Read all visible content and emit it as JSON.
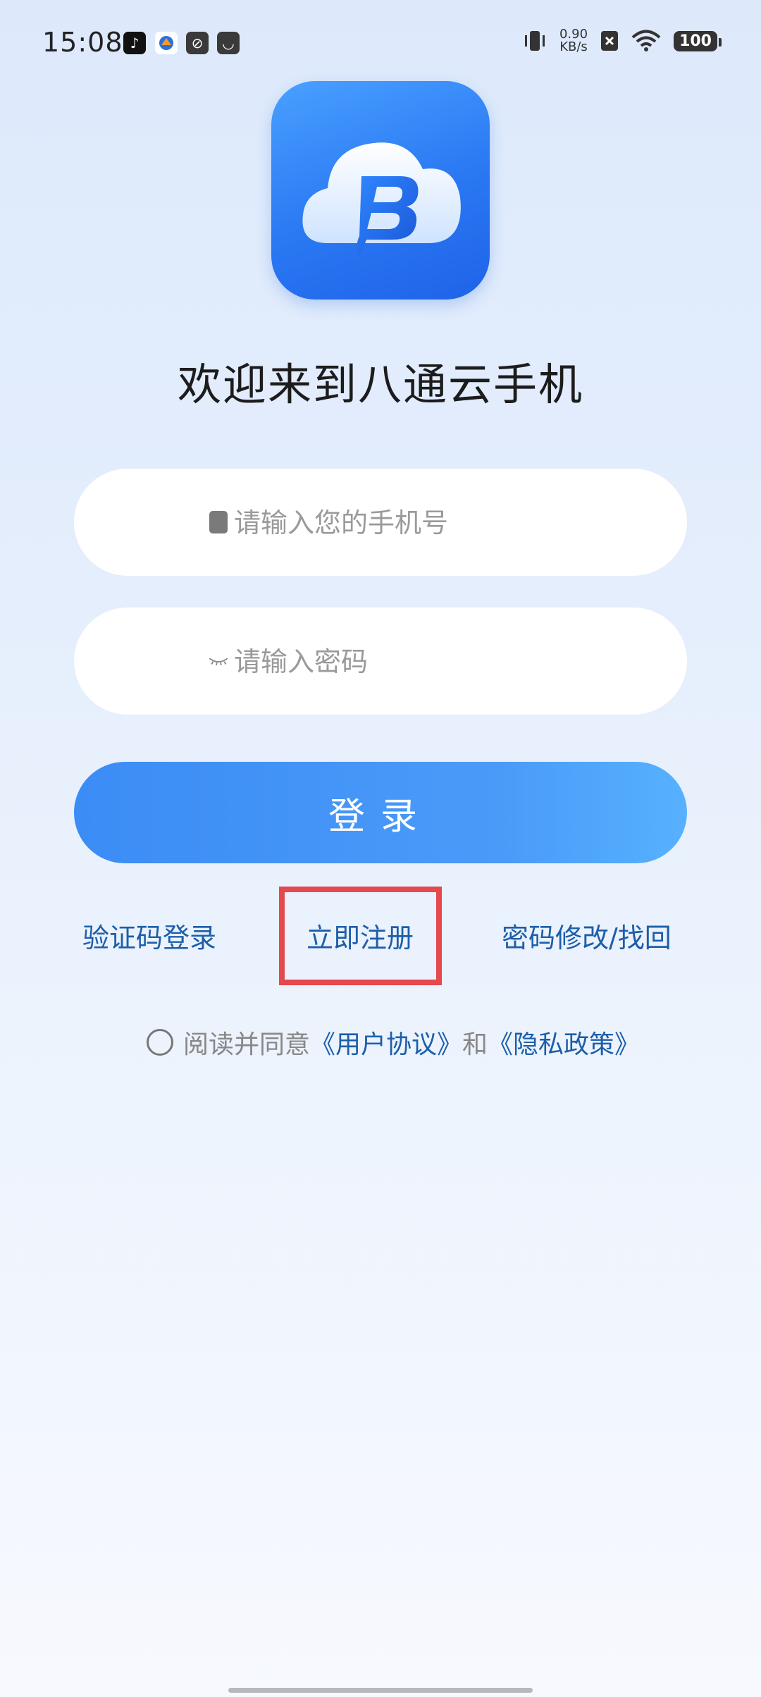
{
  "status_bar": {
    "time": "15:08",
    "net_speed_value": "0.90",
    "net_speed_unit": "KB/s",
    "battery": "100"
  },
  "welcome": {
    "title": "欢迎来到八通云手机"
  },
  "form": {
    "phone_placeholder": "请输入您的手机号",
    "password_placeholder": "请输入密码",
    "login_label": "登录"
  },
  "links": {
    "sms_login": "验证码登录",
    "register": "立即注册",
    "recover_password": "密码修改/找回"
  },
  "agreement": {
    "prefix": "阅读并同意",
    "user_agreement": "《用户协议》",
    "and": "和",
    "privacy_policy": "《隐私政策》"
  },
  "colors": {
    "accent": "#3b8cf5",
    "link": "#1d5eaa",
    "highlight": "#e5484d"
  }
}
